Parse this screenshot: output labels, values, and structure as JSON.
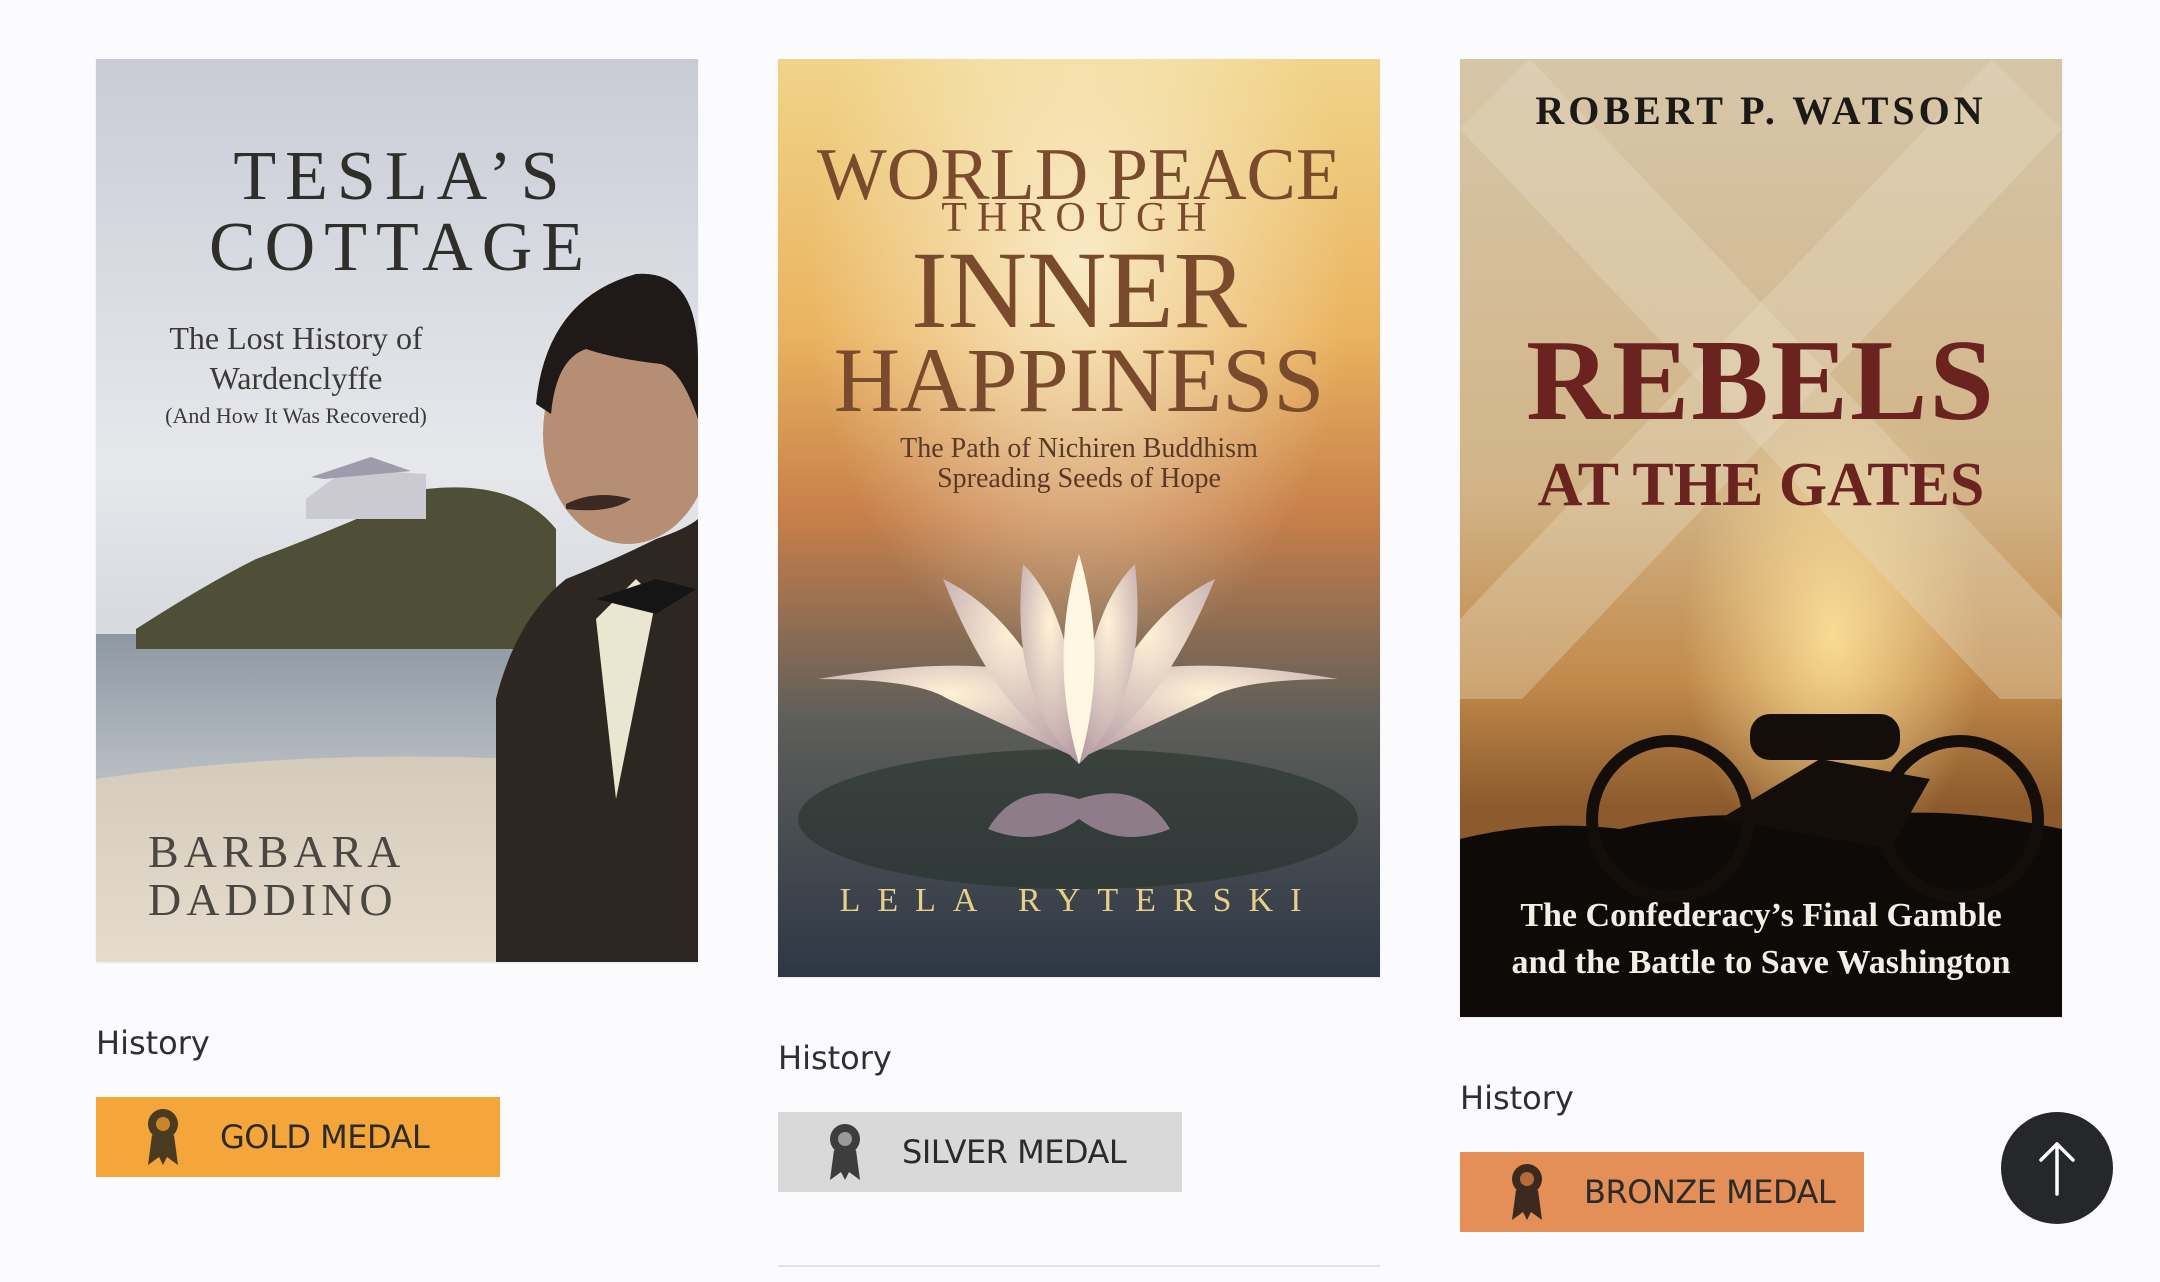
{
  "colors": {
    "page_background": "#fbfafd",
    "gold_medal": "#f5a63a",
    "silver_medal": "#d9d9da",
    "bronze_medal": "#e48f57",
    "scroll_button": "#25272a"
  },
  "books": [
    {
      "cover": {
        "title_line1": "TESLA’S",
        "title_line2": "COTTAGE",
        "subtitle_line1": "The Lost History of",
        "subtitle_line2": "Wardenclyffe",
        "subtitle_line3": "(And How It Was Recovered)",
        "author_line1": "BARBARA",
        "author_line2": "DADDINO"
      },
      "category": "History",
      "medal": {
        "label": "GOLD MEDAL",
        "icon": "award-ribbon-icon"
      }
    },
    {
      "cover": {
        "title_line1": "WORLD PEACE",
        "title_line2": "THROUGH",
        "title_line3": "INNER",
        "title_line4": "HAPPINESS",
        "subtitle_line1": "The Path of Nichiren Buddhism",
        "subtitle_line2": "Spreading Seeds of Hope",
        "author": "LELA RYTERSKI"
      },
      "category": "History",
      "medal": {
        "label": "SILVER MEDAL",
        "icon": "award-ribbon-icon"
      }
    },
    {
      "cover": {
        "author": "ROBERT P. WATSON",
        "title_line1": "REBELS",
        "title_line2": "AT THE GATES",
        "subtitle_line1": "The Confederacy’s Final Gamble",
        "subtitle_line2": "and the Battle to Save Washington"
      },
      "category": "History",
      "medal": {
        "label": "BRONZE MEDAL",
        "icon": "award-ribbon-icon"
      }
    }
  ],
  "scroll_top": {
    "icon": "arrow-up-icon"
  }
}
